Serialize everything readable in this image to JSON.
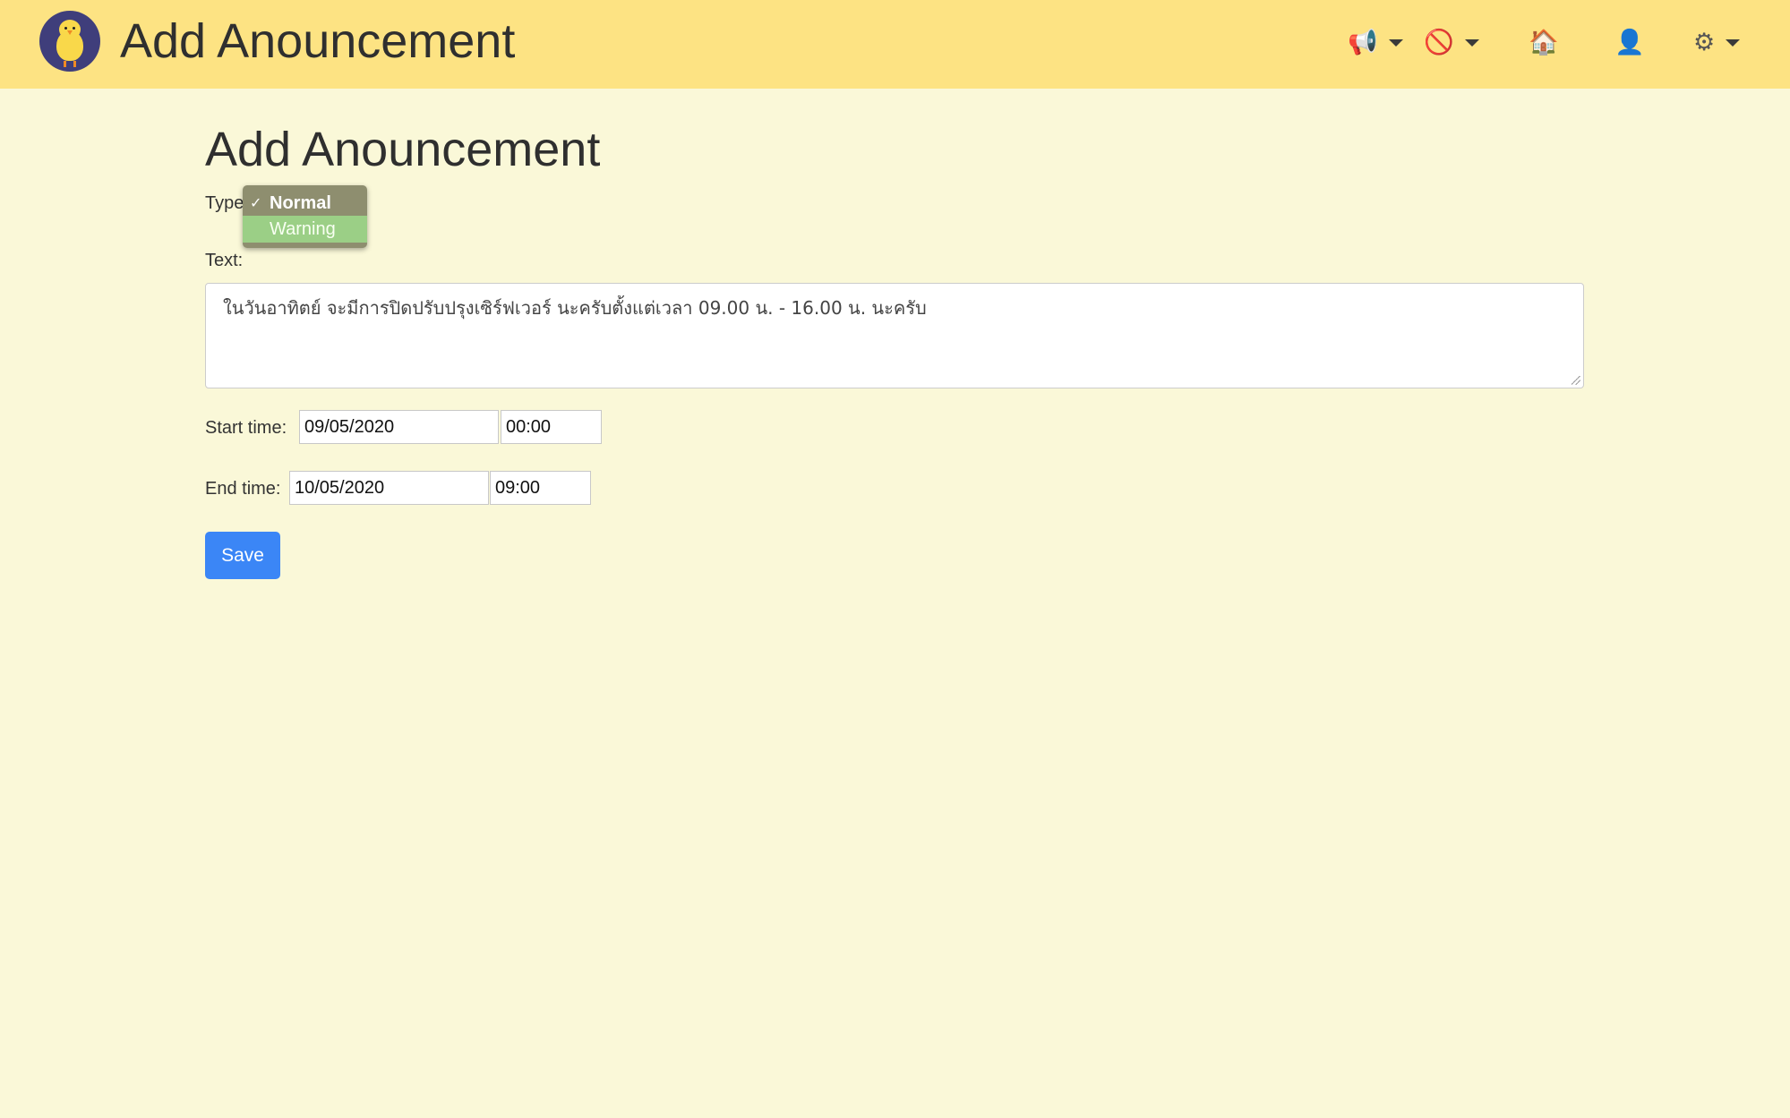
{
  "header": {
    "app_title": "Add Anouncement",
    "icons": [
      "chick-logo-icon",
      "megaphone-icon",
      "prohibited-icon",
      "house-icon",
      "user-icon",
      "gear-icon"
    ]
  },
  "icons": {
    "megaphone": "📢",
    "prohibited": "🚫",
    "house": "🏠",
    "user": "👤",
    "gear": "⚙"
  },
  "page": {
    "title": "Add Anouncement"
  },
  "form": {
    "type_label": "Type",
    "type_options": [
      "Normal",
      "Warning"
    ],
    "type_selected": "Normal",
    "type_highlighted": "Warning",
    "check_mark": "✓",
    "text_label": "Text:",
    "text_value": "ในวันอาทิตย์ จะมีการปิดปรับปรุงเซิร์ฟเวอร์ นะครับตั้งแต่เวลา 09.00 น. - 16.00 น. นะครับ",
    "start_label": "Start time:",
    "start_date": "09/05/2020",
    "start_time": "00:00",
    "end_label": "End time:",
    "end_date": "10/05/2020",
    "end_time": "09:00",
    "save_label": "Save"
  },
  "colors": {
    "navbar": "#fde383",
    "background": "#faf8d8",
    "save_button": "#3b86f6",
    "option_highlight": "#9bcf86"
  }
}
